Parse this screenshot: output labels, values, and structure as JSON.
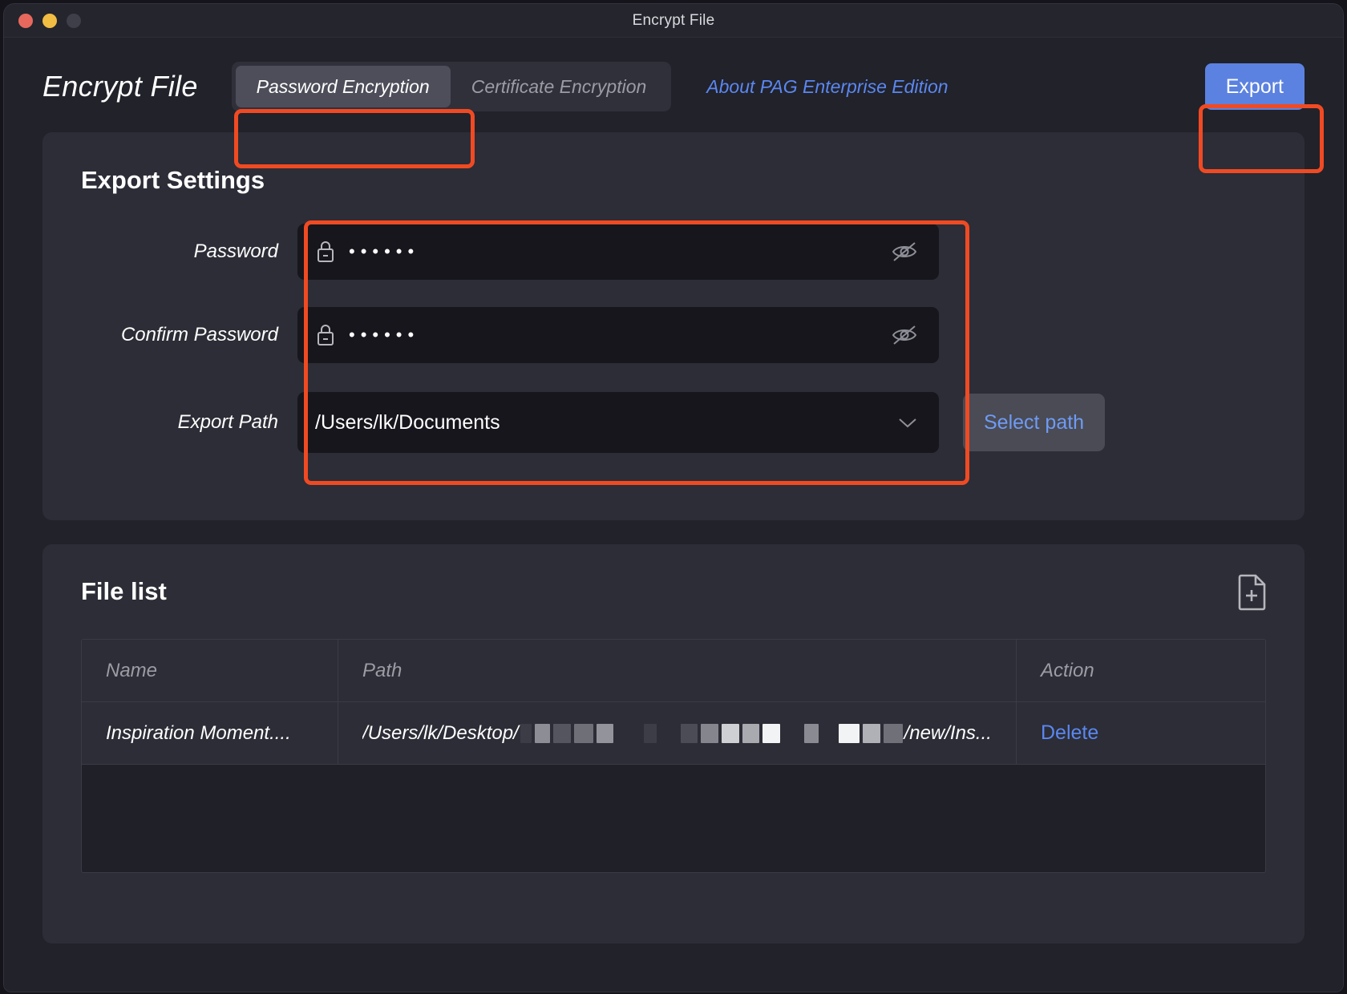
{
  "window": {
    "title": "Encrypt File",
    "traffic_lights": [
      "close-button",
      "minimize-button",
      "zoom-button"
    ]
  },
  "header": {
    "page_title": "Encrypt File",
    "tabs": [
      {
        "label": "Password Encryption",
        "active": true
      },
      {
        "label": "Certificate Encryption",
        "active": false
      }
    ],
    "about_link": "About PAG Enterprise Edition",
    "export_button": "Export"
  },
  "export_settings": {
    "title": "Export Settings",
    "password": {
      "label": "Password",
      "value": "••••••",
      "icon": "lock-icon",
      "toggle_icon": "eye-off-icon"
    },
    "confirm_password": {
      "label": "Confirm Password",
      "value": "••••••",
      "icon": "lock-icon",
      "toggle_icon": "eye-off-icon"
    },
    "export_path": {
      "label": "Export Path",
      "value": "/Users/lk/Documents",
      "dropdown_icon": "chevron-down-icon"
    },
    "select_path_button": "Select path"
  },
  "file_list": {
    "title": "File list",
    "add_icon": "add-file-icon",
    "columns": [
      "Name",
      "Path",
      "Action"
    ],
    "rows": [
      {
        "name": "Inspiration Moment....",
        "path_prefix": "/Users/lk/Desktop/",
        "path_suffix": "/new/Ins...",
        "action": "Delete"
      }
    ]
  },
  "colors": {
    "accent_blue": "#5b82e0",
    "link_blue": "#5b87f0",
    "annotation_orange": "#f04a23",
    "window_bg": "#21222a",
    "panel_bg": "#2c2d36",
    "field_bg": "#16161c"
  }
}
